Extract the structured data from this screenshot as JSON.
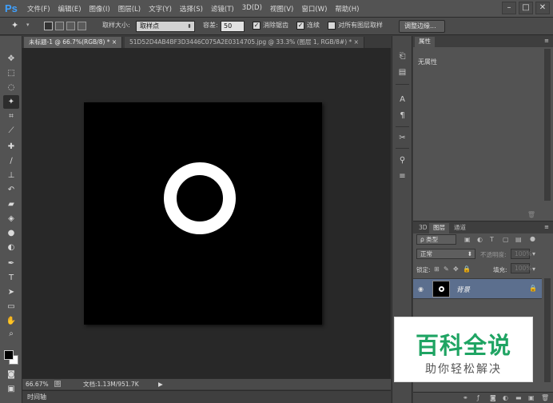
{
  "app": {
    "logo": "Ps"
  },
  "menu": [
    "文件(F)",
    "编辑(E)",
    "图像(I)",
    "图层(L)",
    "文字(Y)",
    "选择(S)",
    "滤镜(T)",
    "3D(D)",
    "视图(V)",
    "窗口(W)",
    "帮助(H)"
  ],
  "window_controls": {
    "minimize": "–",
    "maximize": "□",
    "close": "✕"
  },
  "options": {
    "sample_size_label": "取样大小:",
    "sample_size_value": "取样点",
    "tolerance_label": "容差:",
    "tolerance_value": "50",
    "antialias_label": "消除锯齿",
    "antialias_checked": "✓",
    "contiguous_label": "连续",
    "contiguous_checked": "✓",
    "all_layers_label": "对所有图层取样",
    "refine_edge": "调整边缘..."
  },
  "tabs": [
    {
      "label": "未标题-1 @ 66.7%(RGB/8) *",
      "close": "×"
    },
    {
      "label": "51D52D4AB4BF3D3446C075A2E0314705.jpg @ 33.3% (图层 1, RGB/8#) *",
      "close": "×"
    }
  ],
  "status": {
    "zoom": "66.67%",
    "doc_info": "文档:1.13M/951.7K"
  },
  "timeline_label": "时间轴",
  "properties": {
    "tab": "属性",
    "content": "无属性"
  },
  "layers_panel": {
    "tabs": [
      "3D",
      "图层",
      "通道"
    ],
    "filter_label": "ρ 类型",
    "blend_mode": "正常",
    "opacity_label": "不透明度:",
    "opacity_value": "100%",
    "lock_label": "锁定:",
    "fill_label": "填充:",
    "fill_value": "100%",
    "layer_name": "背景"
  },
  "watermark": {
    "main": "百科全说",
    "sub": "助你轻松解决"
  }
}
